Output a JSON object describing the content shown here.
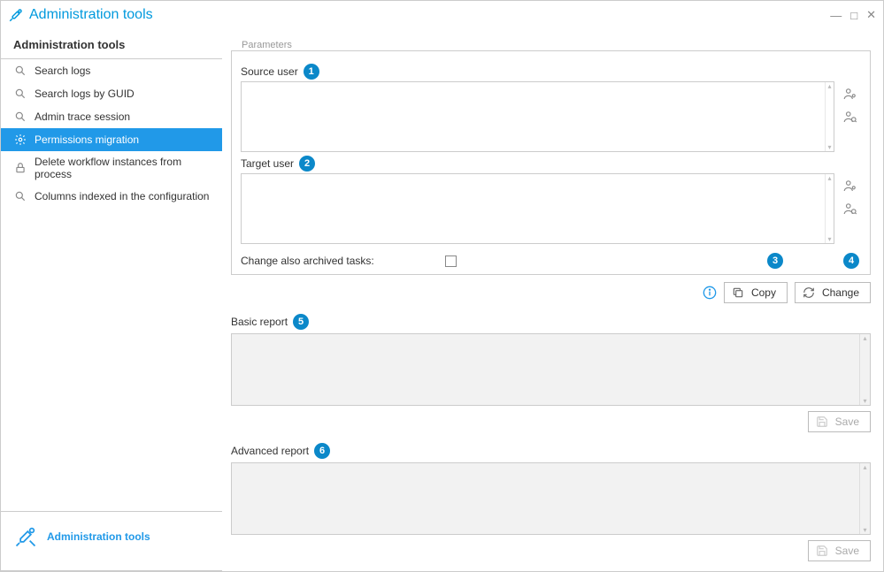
{
  "title": "Administration tools",
  "sidebar": {
    "header": "Administration tools",
    "items": [
      {
        "label": "Search logs",
        "icon": "search"
      },
      {
        "label": "Search logs by GUID",
        "icon": "search"
      },
      {
        "label": "Admin trace session",
        "icon": "search"
      },
      {
        "label": "Permissions migration",
        "icon": "gear",
        "selected": true
      },
      {
        "label": "Delete workflow instances from process",
        "icon": "lock"
      },
      {
        "label": "Columns indexed in the configuration",
        "icon": "search"
      }
    ],
    "footer": "Administration tools"
  },
  "parameters": {
    "legend": "Parameters",
    "source_label": "Source user",
    "target_label": "Target user",
    "checkbox_label": "Change also archived tasks:"
  },
  "actions": {
    "copy": "Copy",
    "change": "Change",
    "save": "Save"
  },
  "reports": {
    "basic": "Basic report",
    "advanced": "Advanced report"
  },
  "annotations": {
    "b1": "1",
    "b2": "2",
    "b3": "3",
    "b4": "4",
    "b5": "5",
    "b6": "6"
  }
}
